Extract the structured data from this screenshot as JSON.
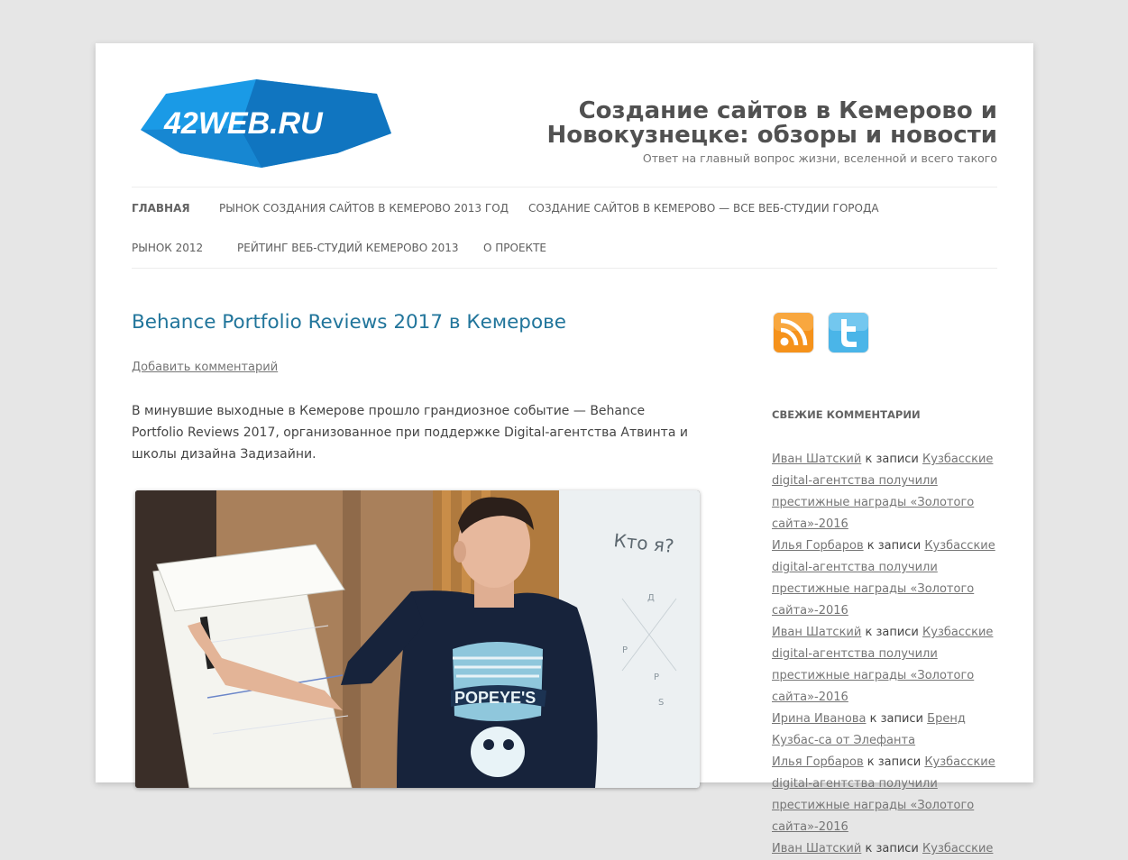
{
  "site": {
    "logo_text": "42WEB.RU",
    "title_line1": "Создание сайтов в Кемерово и",
    "title_line2": "Новокузнецке: обзоры и новости",
    "description": "Ответ на главный вопрос жизни, вселенной и всего такого"
  },
  "nav": {
    "items": [
      {
        "label": "Главная",
        "active": true
      },
      {
        "label": "Рынок создания сайтов в Кемерово 2013 год"
      },
      {
        "label": "Создание сайтов в Кемерово — все веб-студии города"
      },
      {
        "label": "Рынок 2012"
      },
      {
        "label": "Рейтинг веб-студий Кемерово 2013"
      },
      {
        "label": "О проекте"
      }
    ]
  },
  "post": {
    "title": "Behance Portfolio Reviews 2017 в Кемерове",
    "comments_link": "Добавить комментарий",
    "text": "В минувшие выходные в Кемерове прошло грандиозное событие — Behance Portfolio Reviews 2017, организованное при поддержке Digital-агентства Атвинта и школы дизайна Задизайни.",
    "photo": {
      "board_text": "Кто я?",
      "board_letters": [
        "Д",
        "Р",
        "Р",
        "S"
      ],
      "shirt_text": "POPEYE'S"
    }
  },
  "sidebar": {
    "social": [
      {
        "icon": "rss-icon",
        "color": "#f5921b"
      },
      {
        "icon": "twitter-icon",
        "color": "#4ab5e8"
      }
    ],
    "widget_title": "Свежие комментарии",
    "recent_comments": [
      {
        "author": "Иван Шатский",
        "connector": " к записи ",
        "post": "Кузбасские digital-агентства получили престижные награды «Золотого сайта»-2016"
      },
      {
        "author": "Илья Горбаров",
        "connector": " к записи ",
        "post": "Кузбасские digital-агентства получили престижные награды «Золотого сайта»-2016"
      },
      {
        "author": "Иван Шатский",
        "connector": " к записи ",
        "post": "Кузбасские digital-агентства получили престижные награды «Золотого сайта»-2016"
      },
      {
        "author": "Ирина Иванова",
        "connector": " к записи ",
        "post": "Бренд Кузбас-са от Элефанта"
      },
      {
        "author": "Илья Горбаров",
        "connector": " к записи ",
        "post": "Кузбасские digital-агентства получили престижные награды «Золотого сайта»-2016"
      },
      {
        "author": "Иван Шатский",
        "connector": " к записи ",
        "post": "Кузбасские"
      }
    ]
  },
  "colors": {
    "link": "#21759b",
    "logo_blue": "#1a8fd8",
    "logo_dark": "#0e5fa3"
  }
}
